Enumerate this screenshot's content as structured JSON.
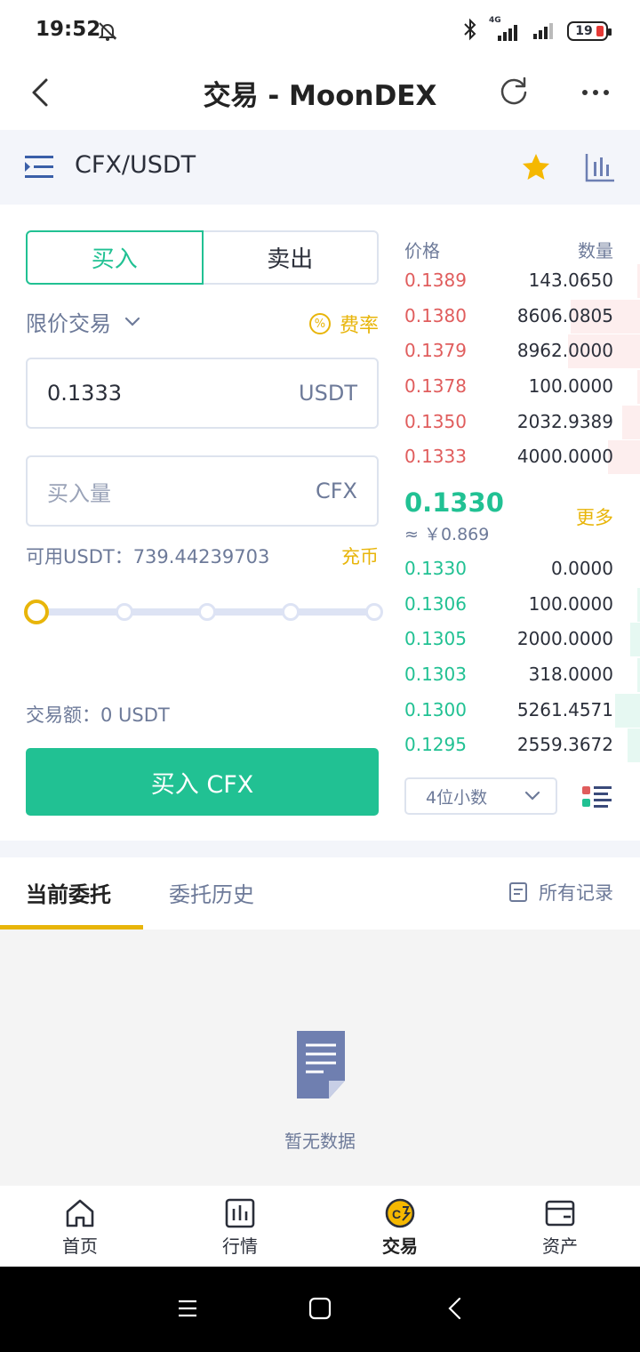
{
  "status": {
    "time": "19:52",
    "network": "4G",
    "battery": "19"
  },
  "header": {
    "title": "交易 - MoonDEX"
  },
  "pair": {
    "name": "CFX/USDT",
    "accent": "#e8b50a"
  },
  "trade": {
    "tab_buy": "买入",
    "tab_sell": "卖出",
    "order_type": "限价交易",
    "fee_label": "费率",
    "fee_icon_text": "%",
    "price_value": "0.1333",
    "price_unit": "USDT",
    "amount_placeholder": "买入量",
    "amount_unit": "CFX",
    "available": "可用USDT：739.44239703",
    "deposit_label": "充币",
    "slider_value": 0,
    "total": "交易额：0 USDT",
    "buy_button": "买入 CFX",
    "buy_color": "#21c193"
  },
  "orderbook": {
    "price_header": "价格",
    "qty_header": "数量",
    "asks": [
      {
        "price": "0.1389",
        "qty": "143.0650",
        "depth": 0.01
      },
      {
        "price": "0.1380",
        "qty": "8606.0805",
        "depth": 0.28
      },
      {
        "price": "0.1379",
        "qty": "8962.0000",
        "depth": 0.29
      },
      {
        "price": "0.1378",
        "qty": "100.0000",
        "depth": 0.01
      },
      {
        "price": "0.1350",
        "qty": "2032.9389",
        "depth": 0.07
      },
      {
        "price": "0.1333",
        "qty": "4000.0000",
        "depth": 0.13
      }
    ],
    "last_price": "0.1330",
    "last_price_cny": "≈ ￥0.869",
    "more_label": "更多",
    "bids": [
      {
        "price": "0.1330",
        "qty": "0.0000",
        "depth": 0.0
      },
      {
        "price": "0.1306",
        "qty": "100.0000",
        "depth": 0.01
      },
      {
        "price": "0.1305",
        "qty": "2000.0000",
        "depth": 0.04
      },
      {
        "price": "0.1303",
        "qty": "318.0000",
        "depth": 0.01
      },
      {
        "price": "0.1300",
        "qty": "5261.4571",
        "depth": 0.1
      },
      {
        "price": "0.1295",
        "qty": "2559.3672",
        "depth": 0.05
      }
    ],
    "decimals": "4位小数",
    "ask_color": "#e05d5d",
    "bid_color": "#21c193"
  },
  "orders": {
    "tab_current": "当前委托",
    "tab_history": "委托历史",
    "all_records": "所有记录",
    "empty": "暂无数据"
  },
  "nav": {
    "home": "首页",
    "market": "行情",
    "trade": "交易",
    "assets": "资产"
  }
}
